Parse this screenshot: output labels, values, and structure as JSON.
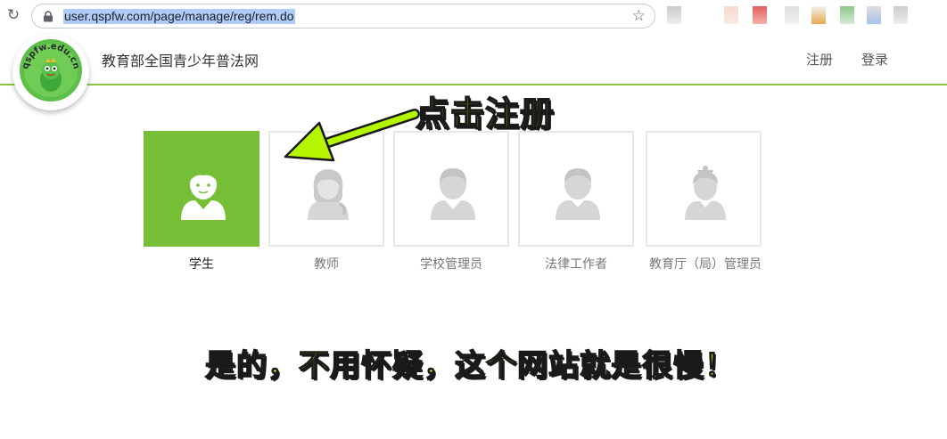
{
  "browser": {
    "url": "user.qspfw.com/page/manage/reg/rem.do",
    "reload_icon": "reload-icon",
    "star_icon": "star-icon"
  },
  "header": {
    "logo_text": "qspfw.edu.cn",
    "site_title": "教育部全国青少年普法网",
    "nav": {
      "register": "注册",
      "login": "登录"
    }
  },
  "roles": [
    {
      "label": "学生",
      "selected": true
    },
    {
      "label": "教师",
      "selected": false
    },
    {
      "label": "学校管理员",
      "selected": false
    },
    {
      "label": "法律工作者",
      "selected": false
    },
    {
      "label": "教育厅（局）管理员",
      "selected": false
    }
  ],
  "annotations": {
    "click_hint": "点击注册",
    "slow_note": "是的，不用怀疑，这个网站就是很慢！"
  },
  "colors": {
    "accent_green": "#75be35",
    "header_line": "#8cc63f",
    "annotation": "#b6f500",
    "icon_gray": "#d6d6d6"
  }
}
